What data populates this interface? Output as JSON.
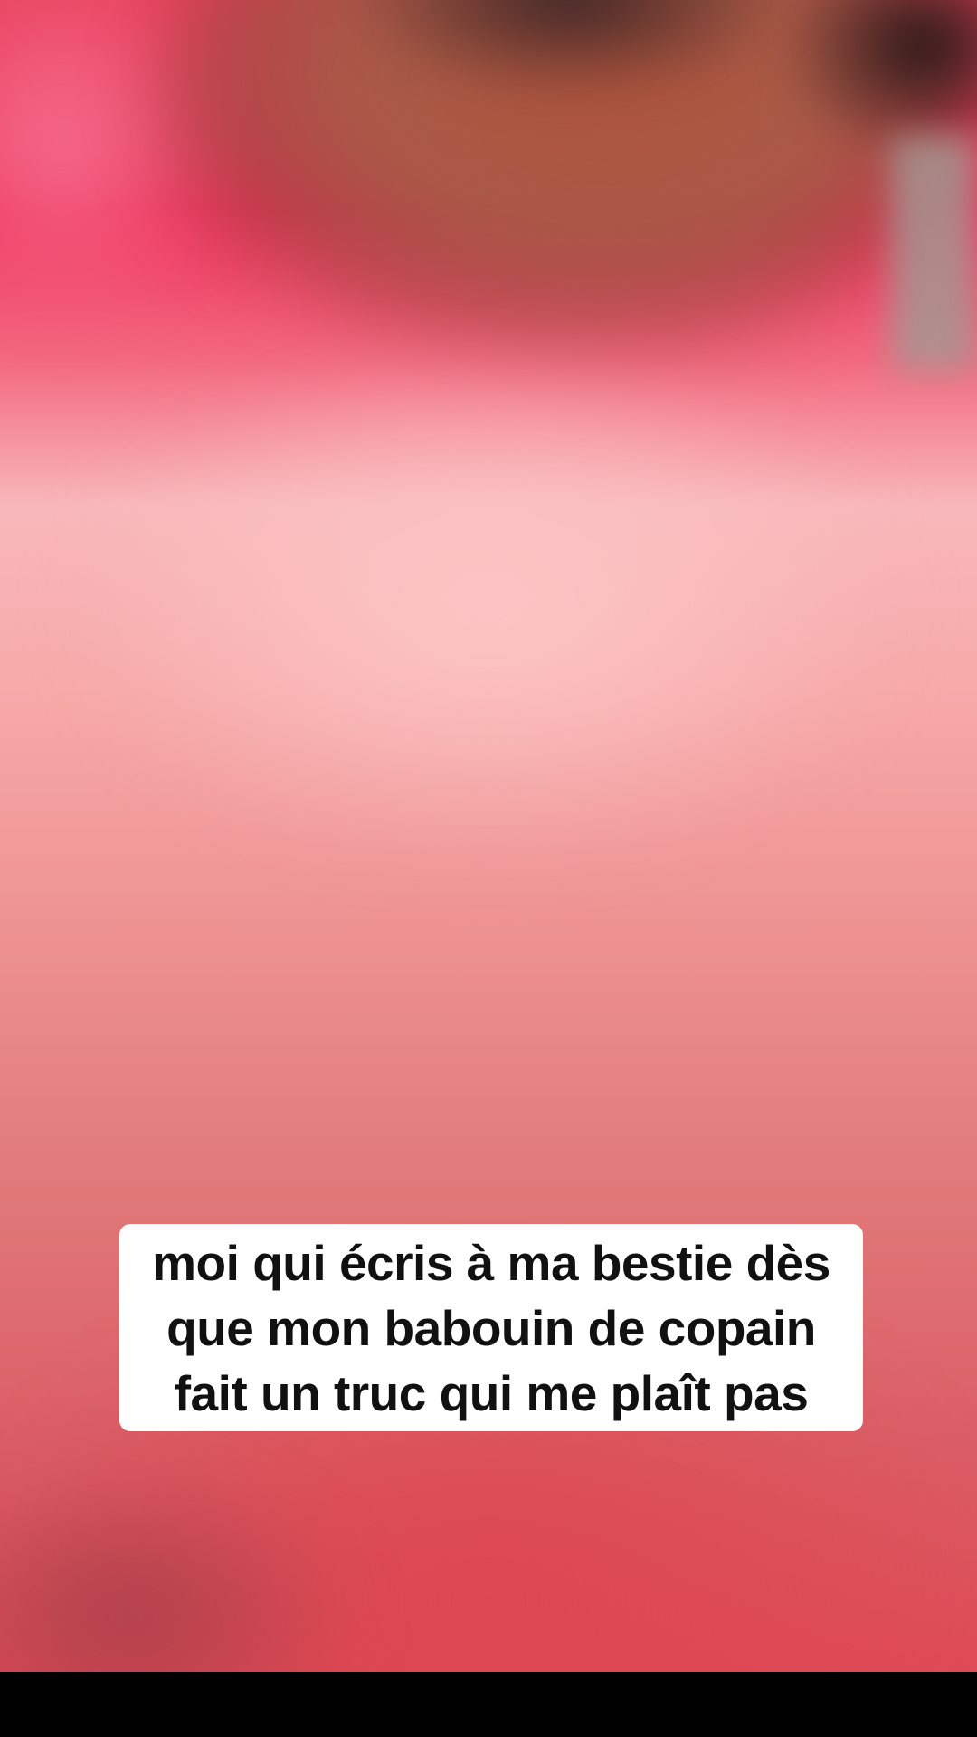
{
  "caption": {
    "lines": [
      "moi qui écris à ma bestie dès",
      "que mon babouin de copain",
      "fait un truc qui me plaît pas"
    ]
  },
  "colors": {
    "background_top": "#ef2f5a",
    "background_mid": "#f8b8bb",
    "background_bottom": "#de4a56",
    "hair": "#b0533a",
    "caption_box": "#ffffff",
    "caption_text": "#111111",
    "bottom_bar": "#000000"
  }
}
